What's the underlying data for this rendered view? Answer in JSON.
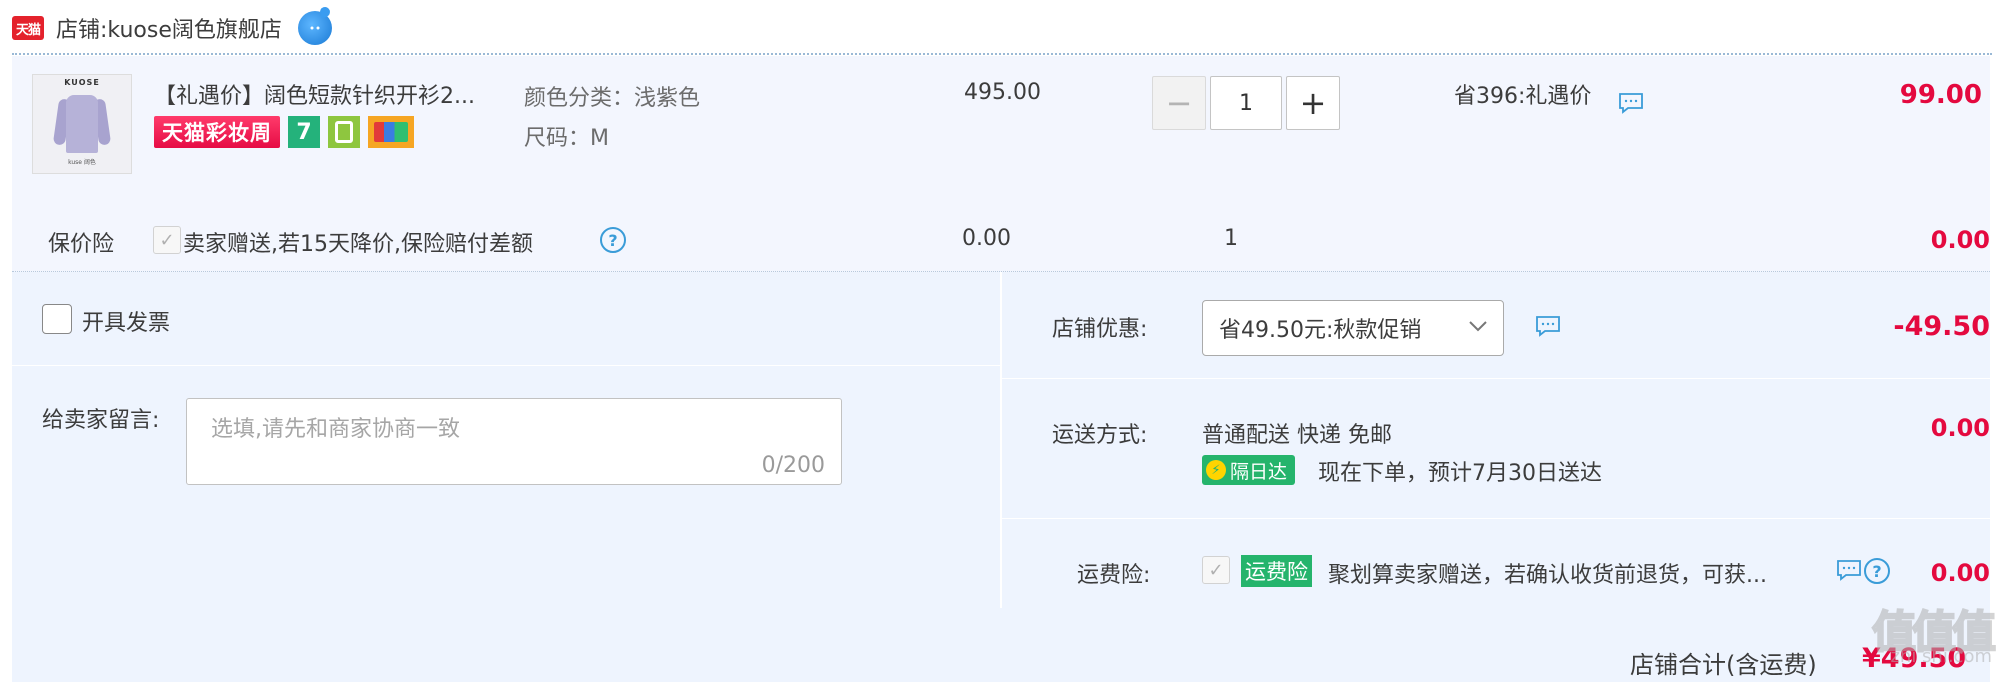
{
  "shop": {
    "logo_text": "天猫",
    "prefix": "店铺: ",
    "name": "kuose阔色旗舰店"
  },
  "item": {
    "thumb_brand": "KUOSE",
    "thumb_caption": "kuse 阔色",
    "title": "【礼遇价】阔色短款针织开衫2...",
    "festival_badge": "天猫彩妆周",
    "badge_7": "7",
    "sku_color": "颜色分类：浅紫色",
    "sku_size": "尺码：M",
    "unit_price": "495.00",
    "qty_minus": "−",
    "qty_value": "1",
    "qty_plus": "+",
    "discount_label": "省396:礼遇价",
    "total": "99.00"
  },
  "insurance": {
    "label": "保价险",
    "desc": "卖家赠送,若15天降价,保险赔付差额",
    "price": "0.00",
    "qty": "1",
    "total": "0.00"
  },
  "invoice": {
    "label": "开具发票"
  },
  "message": {
    "label": "给卖家留言:",
    "placeholder": "选填,请先和商家协商一致",
    "counter": "0/200"
  },
  "coupon": {
    "label": "店铺优惠:",
    "selected": "省49.50元:秋款促销",
    "total": "-49.50"
  },
  "shipping": {
    "label": "运送方式:",
    "method": "普通配送 快递 免邮",
    "badge": "隔日达",
    "estimate": "现在下单，预计7月30日送达",
    "total": "0.00"
  },
  "freight_insurance": {
    "label": "运费险:",
    "badge": "运费险",
    "desc": "聚划算卖家赠送，若确认收货前退货，可获...",
    "total": "0.00"
  },
  "shop_total": {
    "label": "店铺合计(含运费)",
    "amount": "¥49.50"
  },
  "watermark": {
    "glyphs": "值值值",
    "text": "zhi shi.com"
  },
  "colors": {
    "accent_red": "#e4093f",
    "panel_bg": "#eef4fe",
    "item_bg": "#f3f6fe",
    "green_badge": "#25b46c",
    "link_blue": "#3a9cd8"
  }
}
